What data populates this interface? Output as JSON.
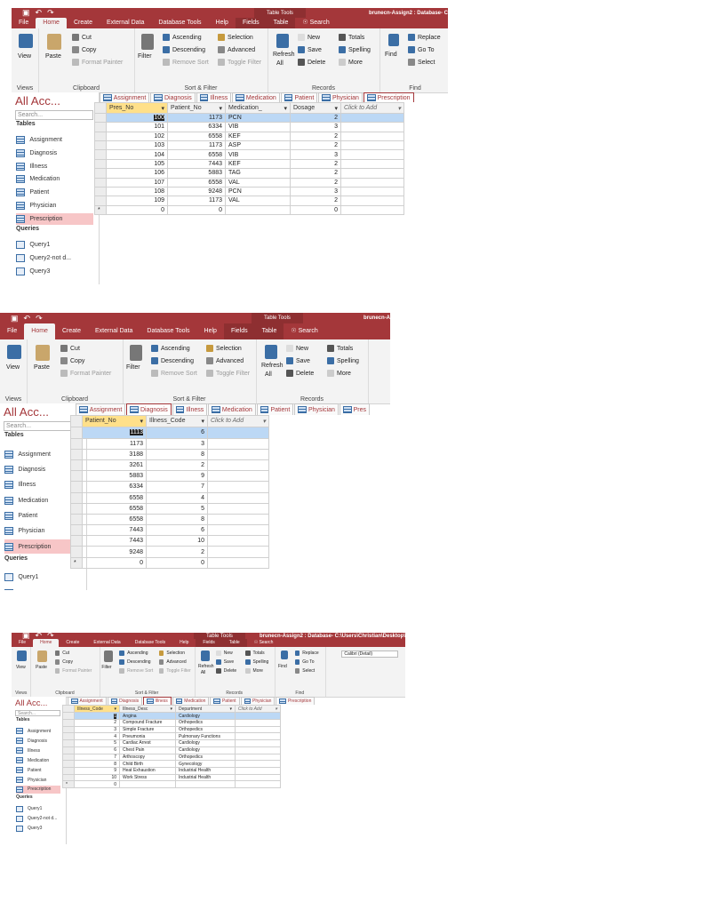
{
  "ribbon": {
    "menu": [
      "File",
      "Home",
      "Create",
      "External Data",
      "Database Tools",
      "Help",
      "Fields",
      "Table"
    ],
    "search": "Search",
    "context_tab": "Table Tools",
    "views": {
      "view": "View",
      "label": "Views"
    },
    "clipboard": {
      "paste": "Paste",
      "cut": "Cut",
      "copy": "Copy",
      "format_painter": "Format Painter",
      "label": "Clipboard"
    },
    "sort_filter": {
      "filter": "Filter",
      "ascending": "Ascending",
      "descending": "Descending",
      "remove_sort": "Remove Sort",
      "selection": "Selection",
      "advanced": "Advanced",
      "toggle_filter": "Toggle Filter",
      "label": "Sort & Filter"
    },
    "records": {
      "refresh": "Refresh",
      "refresh_all": "All",
      "new": "New",
      "save": "Save",
      "delete": "Delete",
      "totals": "Totals",
      "spelling": "Spelling",
      "more": "More",
      "label": "Records"
    },
    "find": {
      "find": "Find",
      "replace": "Replace",
      "goto": "Go To",
      "select": "Select",
      "label": "Find"
    },
    "font": {
      "name": "Calibri (Detail)"
    }
  },
  "nav": {
    "title": "All Acc...",
    "search_placeholder": "Search...",
    "tables_header": "Tables",
    "tables": [
      "Assignment",
      "Diagnosis",
      "Illness",
      "Medication",
      "Patient",
      "Physician",
      "Prescription"
    ],
    "queries_header": "Queries",
    "queries": [
      "Query1",
      "Query2-not d...",
      "Query3"
    ]
  },
  "shots": [
    {
      "doc_title": "brunecn-Assign2 : Database- C",
      "tabs": [
        "Assignment",
        "Diagnosis",
        "Illness",
        "Medication",
        "Patient",
        "Physician",
        "Prescription"
      ],
      "active_tab": "Prescription",
      "columns": [
        "Pres_No",
        "Patient_No",
        "Medication_",
        "Dosage",
        "Click to Add"
      ],
      "rows": [
        [
          "100",
          "1173",
          "PCN",
          "2"
        ],
        [
          "101",
          "6334",
          "VIB",
          "3"
        ],
        [
          "102",
          "6558",
          "KEF",
          "2"
        ],
        [
          "103",
          "1173",
          "ASP",
          "2"
        ],
        [
          "104",
          "6558",
          "VIB",
          "3"
        ],
        [
          "105",
          "7443",
          "KEF",
          "2"
        ],
        [
          "106",
          "5883",
          "TAG",
          "2"
        ],
        [
          "107",
          "6558",
          "VAL",
          "2"
        ],
        [
          "108",
          "9248",
          "PCN",
          "3"
        ],
        [
          "109",
          "1173",
          "VAL",
          "2"
        ]
      ],
      "new_row": [
        "0",
        "0",
        "",
        "0"
      ]
    },
    {
      "doc_title": "brunecn-A",
      "tabs": [
        "Assignment",
        "Diagnosis",
        "Illness",
        "Medication",
        "Patient",
        "Physician",
        "Pres"
      ],
      "active_tab": "Diagnosis",
      "columns": [
        "Patient_No",
        "Illness_Code",
        "Click to Add"
      ],
      "rows": [
        [
          "1113",
          "6"
        ],
        [
          "1173",
          "3"
        ],
        [
          "3188",
          "8"
        ],
        [
          "3261",
          "2"
        ],
        [
          "5883",
          "9"
        ],
        [
          "6334",
          "7"
        ],
        [
          "6558",
          "4"
        ],
        [
          "6558",
          "5"
        ],
        [
          "6558",
          "8"
        ],
        [
          "7443",
          "6"
        ],
        [
          "7443",
          "10"
        ],
        [
          "9248",
          "2"
        ]
      ],
      "new_row": [
        "0",
        "0"
      ]
    },
    {
      "doc_title": "brunecn-Assign2 : Database- C:\\Users\\Christian\\Desktop\\",
      "tabs": [
        "Assignment",
        "Diagnosis",
        "Illness",
        "Medication",
        "Patient",
        "Physician",
        "Prescription"
      ],
      "active_tab": "Illness",
      "columns": [
        "Illness_Code",
        "Illness_Desc",
        "Department",
        "Click to Add"
      ],
      "rows": [
        [
          "1",
          "Angina",
          "Cardiology"
        ],
        [
          "2",
          "Compound Fracture",
          "Orthopedics"
        ],
        [
          "3",
          "Simple Fracture",
          "Orthopedics"
        ],
        [
          "4",
          "Pneumonia",
          "Pulmonary Functions"
        ],
        [
          "5",
          "Cardiac Arrest",
          "Cardiology"
        ],
        [
          "6",
          "Chest Pain",
          "Cardiology"
        ],
        [
          "7",
          "Arthoscopy",
          "Orthopedics"
        ],
        [
          "8",
          "Child Birth",
          "Gynecology"
        ],
        [
          "9",
          "Heat Exhaustion",
          "Industrial Health"
        ],
        [
          "10",
          "Work Stress",
          "Industrial Health"
        ]
      ],
      "new_row": [
        "0",
        "",
        ""
      ]
    }
  ]
}
